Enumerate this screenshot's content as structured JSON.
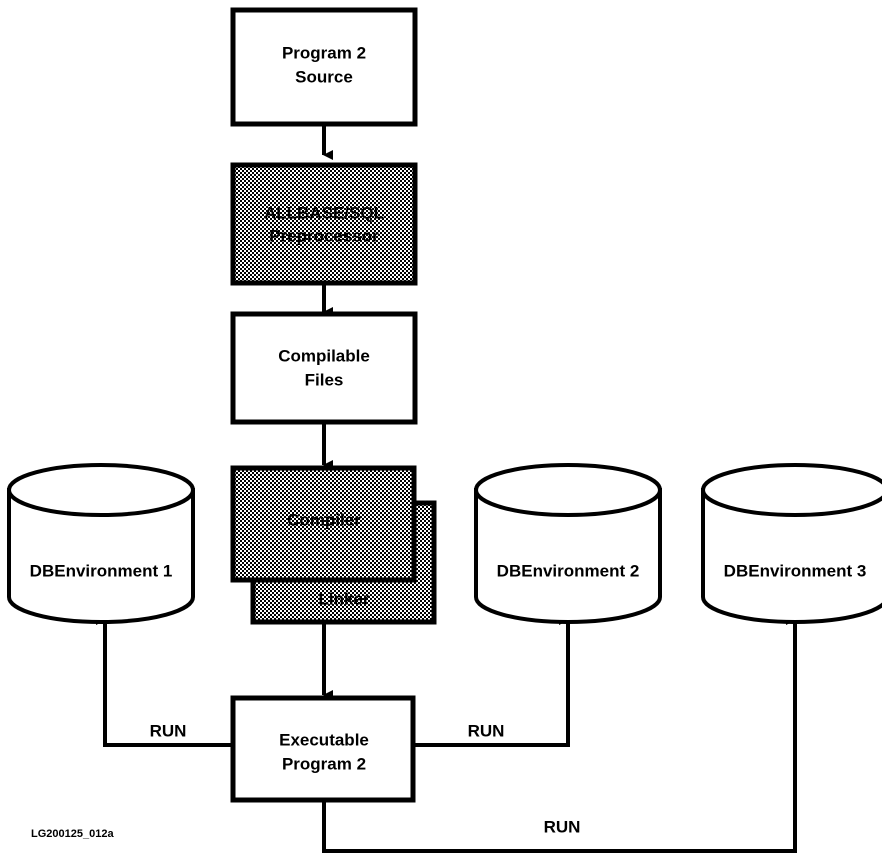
{
  "diagram": {
    "caption": "LG200125_012a",
    "colors": {
      "stroke": "#000000",
      "background": "#ffffff",
      "shaded_fill": "#808080"
    },
    "nodes": [
      {
        "id": "program_source",
        "label_line1": "Program 2",
        "label_line2": "Source",
        "shape": "rectangle",
        "fill": "white"
      },
      {
        "id": "preprocessor",
        "label_line1": "ALLBASE/SQL",
        "label_line2": "Preprocessor",
        "shape": "rectangle",
        "fill": "dithered-gray"
      },
      {
        "id": "compilable_files",
        "label_line1": "Compilable",
        "label_line2": "Files",
        "shape": "rectangle",
        "fill": "white"
      },
      {
        "id": "linker",
        "label_line1": "Linker",
        "label_line2": "",
        "shape": "rectangle",
        "fill": "dithered-gray"
      },
      {
        "id": "compiler",
        "label_line1": "Compiler",
        "label_line2": "",
        "shape": "rectangle",
        "fill": "dithered-gray"
      },
      {
        "id": "executable",
        "label_line1": "Executable",
        "label_line2": "Program 2",
        "shape": "rectangle",
        "fill": "white"
      },
      {
        "id": "dbenv1",
        "label_line1": "DBEnvironment 1",
        "label_line2": "",
        "shape": "cylinder",
        "fill": "white"
      },
      {
        "id": "dbenv2",
        "label_line1": "DBEnvironment 2",
        "label_line2": "",
        "shape": "cylinder",
        "fill": "white"
      },
      {
        "id": "dbenv3",
        "label_line1": "DBEnvironment 3",
        "label_line2": "",
        "shape": "cylinder",
        "fill": "white"
      }
    ],
    "edges": [
      {
        "id": "src_to_prep",
        "from": "program_source",
        "to": "preprocessor",
        "label": "",
        "arrow": true
      },
      {
        "id": "prep_to_files",
        "from": "preprocessor",
        "to": "compilable_files",
        "label": "",
        "arrow": true
      },
      {
        "id": "files_to_compiler",
        "from": "compilable_files",
        "to": "compiler",
        "label": "",
        "arrow": true
      },
      {
        "id": "linker_to_exe",
        "from": "linker",
        "to": "executable",
        "label": "",
        "arrow": true
      },
      {
        "id": "exe_to_db1",
        "from": "executable",
        "to": "dbenv1",
        "label": "RUN",
        "arrow": true
      },
      {
        "id": "exe_to_db2",
        "from": "executable",
        "to": "dbenv2",
        "label": "RUN",
        "arrow": true
      },
      {
        "id": "exe_to_db3",
        "from": "executable",
        "to": "dbenv3",
        "label": "RUN",
        "arrow": true
      }
    ]
  }
}
